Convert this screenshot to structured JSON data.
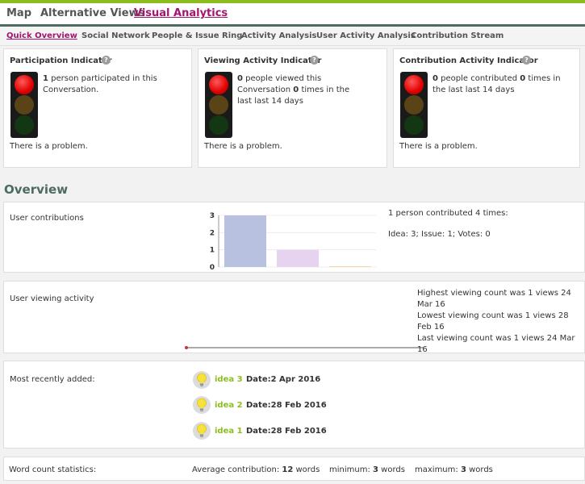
{
  "topnav": {
    "items": [
      "Map",
      "Alternative Views",
      "Visual Analytics"
    ]
  },
  "subnav": {
    "items": [
      "Quick Overview",
      "Social Network",
      "People & Issue Ring",
      "Activity Analysis",
      "User Activity Analysis",
      "Contribution Stream"
    ]
  },
  "indicators": [
    {
      "title": "Participation Indicator",
      "help": "?",
      "count": "1",
      "text_a": " person participated in this Conversation.",
      "count2": "",
      "text_b": "",
      "status": "There is a problem."
    },
    {
      "title": "Viewing Activity Indicator",
      "help": "?",
      "count": "0",
      "text_a": " people viewed this Conversation ",
      "count2": "0",
      "text_b": " times in the last last 14 days",
      "status": "There is a problem."
    },
    {
      "title": "Contribution Activity Indicator",
      "help": "?",
      "count": "0",
      "text_a": " people contributed ",
      "count2": "0",
      "text_b": " times in the last last 14 days",
      "status": "There is a problem."
    }
  ],
  "overview": {
    "heading": "Overview",
    "user_contributions": {
      "label": "User contributions",
      "summary": "1 person contributed 4 times:",
      "breakdown": "Idea: 3; Issue: 1; Votes: 0"
    },
    "user_viewing": {
      "label": "User viewing activity",
      "highest": "Highest viewing count was 1 views 24 Mar 16",
      "lowest": "Lowest viewing count was 1 views 28 Feb 16",
      "last": "Last viewing count was 1 views 24 Mar 16"
    },
    "recent": {
      "label": "Most recently added:",
      "items": [
        {
          "name": "idea 3",
          "date": "Date:2 Apr 2016"
        },
        {
          "name": "idea 2",
          "date": "Date:28 Feb 2016"
        },
        {
          "name": "idea 1",
          "date": "Date:28 Feb 2016"
        }
      ]
    },
    "word_count": {
      "label": "Word count statistics:",
      "avg_label": "Average contribution: ",
      "avg_value": "12",
      "min_label": "minimum: ",
      "min_value": "3",
      "max_label": "maximum: ",
      "max_value": "3",
      "unit": " words"
    }
  },
  "chart_data": {
    "type": "bar",
    "categories": [
      "Idea",
      "Issue",
      "Votes"
    ],
    "values": [
      3,
      1,
      0
    ],
    "ylim": [
      0,
      3
    ],
    "yticks": [
      "0",
      "1",
      "2",
      "3"
    ],
    "colors": [
      "#b8c2e0",
      "#e6d3ef",
      "#f5d7a8"
    ],
    "title": "",
    "xlabel": "",
    "ylabel": ""
  },
  "colors": {
    "accent_green": "#8cbd1f",
    "active_magenta": "#a3156e",
    "heading_green": "#4d6b5e"
  }
}
